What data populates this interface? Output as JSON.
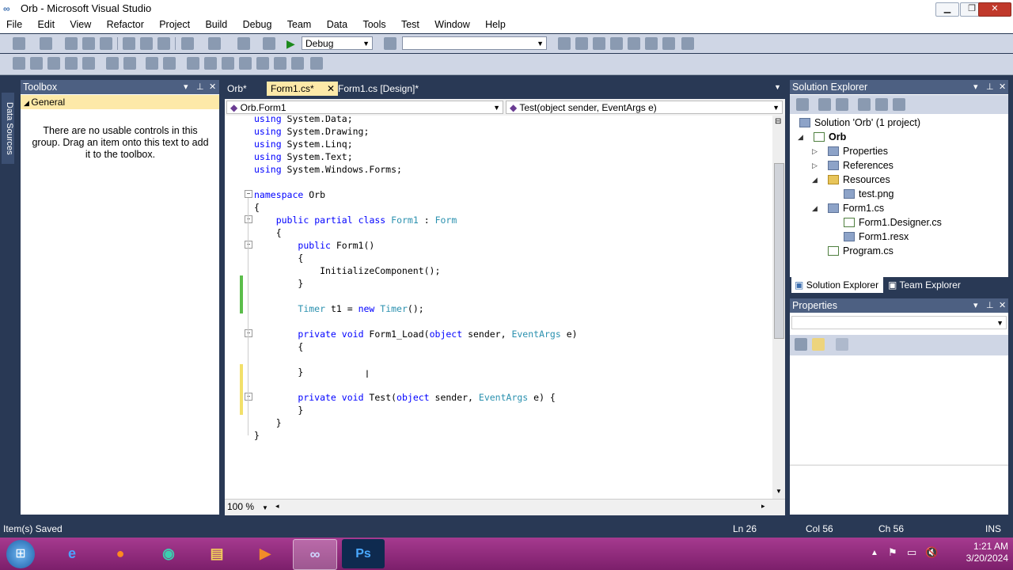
{
  "window": {
    "title": "Orb - Microsoft Visual Studio"
  },
  "menu": [
    "File",
    "Edit",
    "View",
    "Refactor",
    "Project",
    "Build",
    "Debug",
    "Team",
    "Data",
    "Tools",
    "Test",
    "Window",
    "Help"
  ],
  "toolbar": {
    "config": "Debug",
    "platform": ""
  },
  "leftrail": {
    "data_sources_label": "Data Sources"
  },
  "toolbox": {
    "title": "Toolbox",
    "group": "General",
    "empty_message": "There are no usable controls in this group. Drag an item onto this text to add it to the toolbox."
  },
  "doc_tabs": [
    {
      "label": "Orb*"
    },
    {
      "label": "Form1.cs*",
      "active": true
    },
    {
      "label": "Form1.cs [Design]*"
    }
  ],
  "editor": {
    "class_dropdown": "Orb.Form1",
    "member_dropdown": "Test(object sender, EventArgs e)",
    "zoom": "100 %",
    "lines": [
      "using System.Data;",
      "using System.Drawing;",
      "using System.Linq;",
      "using System.Text;",
      "using System.Windows.Forms;",
      "",
      "namespace Orb",
      "{",
      "    public partial class Form1 : Form",
      "    {",
      "        public Form1()",
      "        {",
      "            InitializeComponent();",
      "        }",
      "",
      "        Timer t1 = new Timer();",
      "",
      "        private void Form1_Load(object sender, EventArgs e)",
      "        {",
      "",
      "        }",
      "",
      "        private void Test(object sender, EventArgs e) {",
      "        }",
      "    }",
      "}"
    ]
  },
  "solution_explorer": {
    "title": "Solution Explorer",
    "items": [
      {
        "label": "Solution 'Orb' (1 project)"
      },
      {
        "label": "Orb"
      },
      {
        "label": "Properties"
      },
      {
        "label": "References"
      },
      {
        "label": "Resources"
      },
      {
        "label": "test.png"
      },
      {
        "label": "Form1.cs"
      },
      {
        "label": "Form1.Designer.cs"
      },
      {
        "label": "Form1.resx"
      },
      {
        "label": "Program.cs"
      }
    ],
    "tab_se": "Solution Explorer",
    "tab_te": "Team Explorer"
  },
  "properties": {
    "title": "Properties"
  },
  "status": {
    "message": "Item(s) Saved",
    "ln": "Ln 26",
    "col": "Col 56",
    "ch": "Ch 56",
    "mode": "INS"
  },
  "clock": {
    "time": "1:21 AM",
    "date": "3/20/2024"
  }
}
